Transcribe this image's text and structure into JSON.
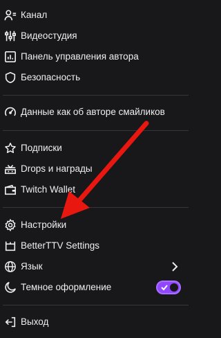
{
  "menu": {
    "channel": "Канал",
    "studio": "Видеостудия",
    "dashboard": "Панель управления автора",
    "security": "Безопасность",
    "emotes": "Данные как об авторе смайликов",
    "subscriptions": "Подписки",
    "drops": "Drops и награды",
    "wallet": "Twitch Wallet",
    "settings": "Настройки",
    "bttv": "BetterTTV Settings",
    "language": "Язык",
    "dark_theme": "Темное оформление",
    "logout": "Выход"
  },
  "dark_theme_enabled": true,
  "colors": {
    "background": "#18181b",
    "text": "#efeff1",
    "divider": "#35353b",
    "accent": "#9147ff",
    "annotation_arrow": "#e8170f"
  },
  "icons": {
    "channel": "user-icon",
    "studio": "sliders-icon",
    "dashboard": "dashboard-icon",
    "security": "shield-icon",
    "emotes": "gauge-icon",
    "subscriptions": "star-icon",
    "drops": "gift-icon",
    "wallet": "wallet-icon",
    "settings": "gear-icon",
    "bttv": "bttv-icon",
    "language": "globe-icon",
    "dark_theme": "moon-icon",
    "logout": "logout-icon"
  }
}
